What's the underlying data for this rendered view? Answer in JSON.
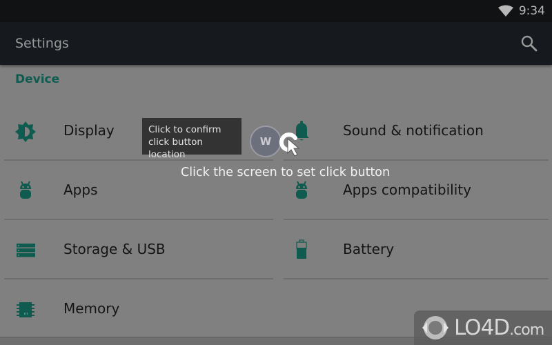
{
  "status_bar": {
    "time": "9:34",
    "wifi_icon": "wifi-icon"
  },
  "app_bar": {
    "title": "Settings",
    "search_icon": "search-icon"
  },
  "section": {
    "title": "Device"
  },
  "settings_items": [
    {
      "label": "Display",
      "icon": "brightness-icon"
    },
    {
      "label": "Sound & notification",
      "icon": "bell-icon"
    },
    {
      "label": "Apps",
      "icon": "android-icon"
    },
    {
      "label": "Apps compatibility",
      "icon": "android-icon"
    },
    {
      "label": "Storage & USB",
      "icon": "storage-icon"
    },
    {
      "label": "Battery",
      "icon": "battery-icon"
    },
    {
      "label": "Memory",
      "icon": "memory-chip-icon"
    }
  ],
  "overlay": {
    "tooltip": "Click to confirm click button location",
    "marker_label": "W",
    "instruction": "Click the screen to set click button"
  },
  "watermark": {
    "brand": "LO4D",
    "suffix": ".com"
  },
  "colors": {
    "accent": "#0f5b4f",
    "background": "#808080",
    "app_bar": "#161a1e",
    "status_bar": "#101214"
  }
}
